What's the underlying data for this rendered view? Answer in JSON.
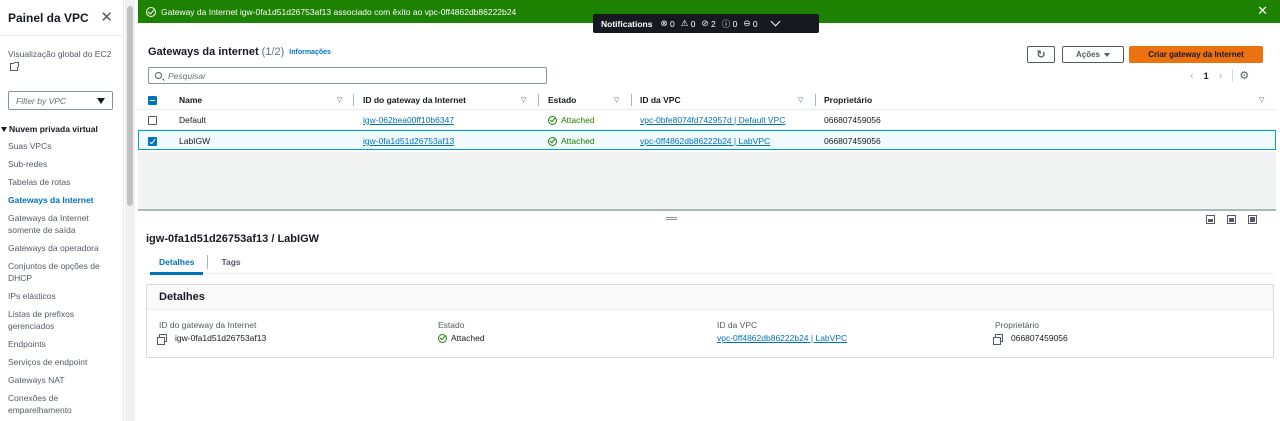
{
  "sidebar": {
    "title": "Painel da VPC",
    "global_view": "Visualização global do EC2",
    "filter_placeholder": "Filter by VPC",
    "section": "Nuvem privada virtual",
    "items": [
      {
        "label": "Suas VPCs"
      },
      {
        "label": "Sub-redes"
      },
      {
        "label": "Tabelas de rotas"
      },
      {
        "label": "Gateways da Internet",
        "active": true
      },
      {
        "label": "Gateways da Internet somente de saída"
      },
      {
        "label": "Gateways da operadora"
      },
      {
        "label": "Conjuntos de opções de DHCP"
      },
      {
        "label": "IPs elásticos"
      },
      {
        "label": "Listas de prefixos gerenciados"
      },
      {
        "label": "Endpoints"
      },
      {
        "label": "Serviços de endpoint"
      },
      {
        "label": "Gateways NAT"
      },
      {
        "label": "Conexões de emparelhamento"
      }
    ]
  },
  "flash": {
    "message": "Gateway da Internet igw-0fa1d51d26753af13 associado com êxito ao vpc-0ff4862db86222b24",
    "color": "#1d8102"
  },
  "notifications": {
    "label": "Notifications",
    "counts": [
      "0",
      "0",
      "2",
      "0",
      "0"
    ]
  },
  "table": {
    "title": "Gateways da internet",
    "count": "(1/2)",
    "info": "Informações",
    "actions_label": "Ações",
    "create_label": "Criar gateway da Internet",
    "search_placeholder": "Pesquisar",
    "page": "1",
    "columns": [
      "Name",
      "ID do gateway da Internet",
      "Estado",
      "ID da VPC",
      "Proprietário"
    ],
    "rows": [
      {
        "name": "Default",
        "id": "igw-062bea00ff10b6347",
        "state": "Attached",
        "vpc": "vpc-0bfe8074fd742957d | Default VPC",
        "owner": "066807459056",
        "selected": false
      },
      {
        "name": "LabIGW",
        "id": "igw-0fa1d51d26753af13",
        "state": "Attached",
        "vpc": "vpc-0ff4862db86222b24 | LabVPC",
        "owner": "066807459056",
        "selected": true
      }
    ]
  },
  "detail": {
    "title": "igw-0fa1d51d26753af13 / LabIGW",
    "tabs": [
      "Detalhes",
      "Tags"
    ],
    "card_title": "Detalhes",
    "fields": {
      "id_label": "ID do gateway da Internet",
      "id_value": "igw-0fa1d51d26753af13",
      "state_label": "Estado",
      "state_value": "Attached",
      "vpc_label": "ID da VPC",
      "vpc_value": "vpc-0ff4862db86222b24 | LabVPC",
      "owner_label": "Proprietário",
      "owner_value": "066807459056"
    }
  },
  "colors": {
    "accent": "#0073bb",
    "primary_button": "#ec7211",
    "success": "#1d8102"
  }
}
